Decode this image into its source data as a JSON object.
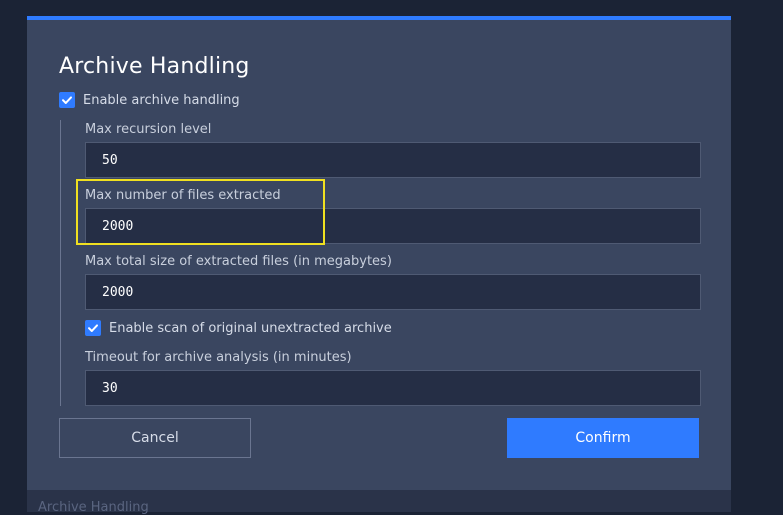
{
  "background": {
    "faded_label": "Archive Handling"
  },
  "dialog": {
    "title": "Archive Handling",
    "accent_color": "#2f7bff",
    "enable_archive": {
      "label": "Enable archive handling",
      "checked": true
    },
    "fields": {
      "max_recursion": {
        "label": "Max recursion level",
        "value": "50"
      },
      "max_files": {
        "label": "Max number of files extracted",
        "value": "2000"
      },
      "max_size": {
        "label": "Max total size of extracted files (in megabytes)",
        "value": "2000"
      },
      "timeout": {
        "label": "Timeout for archive analysis (in minutes)",
        "value": "30"
      }
    },
    "enable_scan_original": {
      "label": "Enable scan of original unextracted archive",
      "checked": true
    },
    "buttons": {
      "cancel": "Cancel",
      "confirm": "Confirm"
    },
    "highlight_color": "#f0e020"
  }
}
